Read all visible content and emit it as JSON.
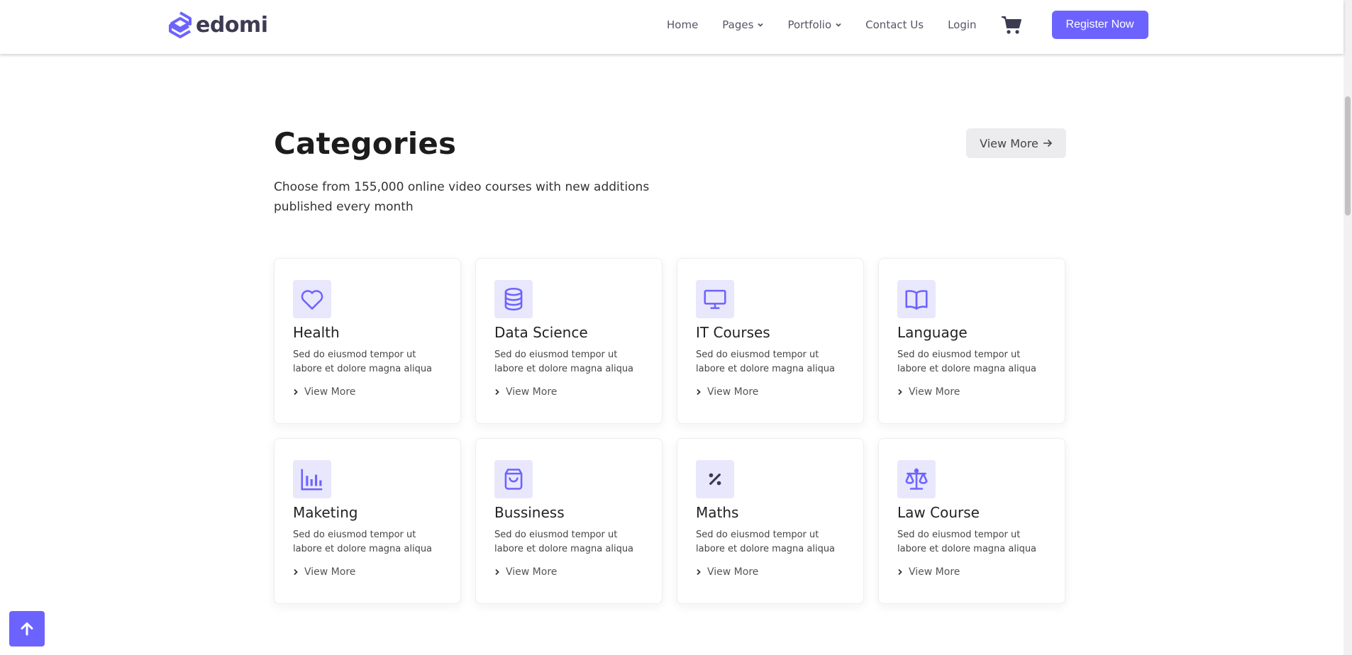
{
  "brand": {
    "name": "edomi",
    "accent": "#6c63ff"
  },
  "nav": {
    "items": [
      {
        "label": "Home",
        "dropdown": false
      },
      {
        "label": "Pages",
        "dropdown": true
      },
      {
        "label": "Portfolio",
        "dropdown": true
      },
      {
        "label": "Contact Us",
        "dropdown": false
      },
      {
        "label": "Login",
        "dropdown": false
      }
    ],
    "cart_icon": "cart-icon",
    "register_label": "Register Now"
  },
  "section": {
    "title": "Categories",
    "description": "Choose from 155,000 online video courses with new additions published every month",
    "view_more_label": "View More"
  },
  "categories": [
    {
      "title": "Health",
      "icon": "heart-icon",
      "text": "Sed do eiusmod tempor ut labore et dolore magna aliqua",
      "link": "View More"
    },
    {
      "title": "Data Science",
      "icon": "database-icon",
      "text": "Sed do eiusmod tempor ut labore et dolore magna aliqua",
      "link": "View More"
    },
    {
      "title": "IT Courses",
      "icon": "monitor-icon",
      "text": "Sed do eiusmod tempor ut labore et dolore magna aliqua",
      "link": "View More"
    },
    {
      "title": "Language",
      "icon": "book-icon",
      "text": "Sed do eiusmod tempor ut labore et dolore magna aliqua",
      "link": "View More"
    },
    {
      "title": "Maketing",
      "icon": "bar-chart-icon",
      "text": "Sed do eiusmod tempor ut labore et dolore magna aliqua",
      "link": "View More"
    },
    {
      "title": "Bussiness",
      "icon": "shopping-bag-icon",
      "text": "Sed do eiusmod tempor ut labore et dolore magna aliqua",
      "link": "View More"
    },
    {
      "title": "Maths",
      "icon": "percent-icon",
      "text": "Sed do eiusmod tempor ut labore et dolore magna aliqua",
      "link": "View More"
    },
    {
      "title": "Law Course",
      "icon": "scale-icon",
      "text": "Sed do eiusmod tempor ut labore et dolore magna aliqua",
      "link": "View More"
    }
  ],
  "back_to_top_icon": "arrow-up-icon"
}
